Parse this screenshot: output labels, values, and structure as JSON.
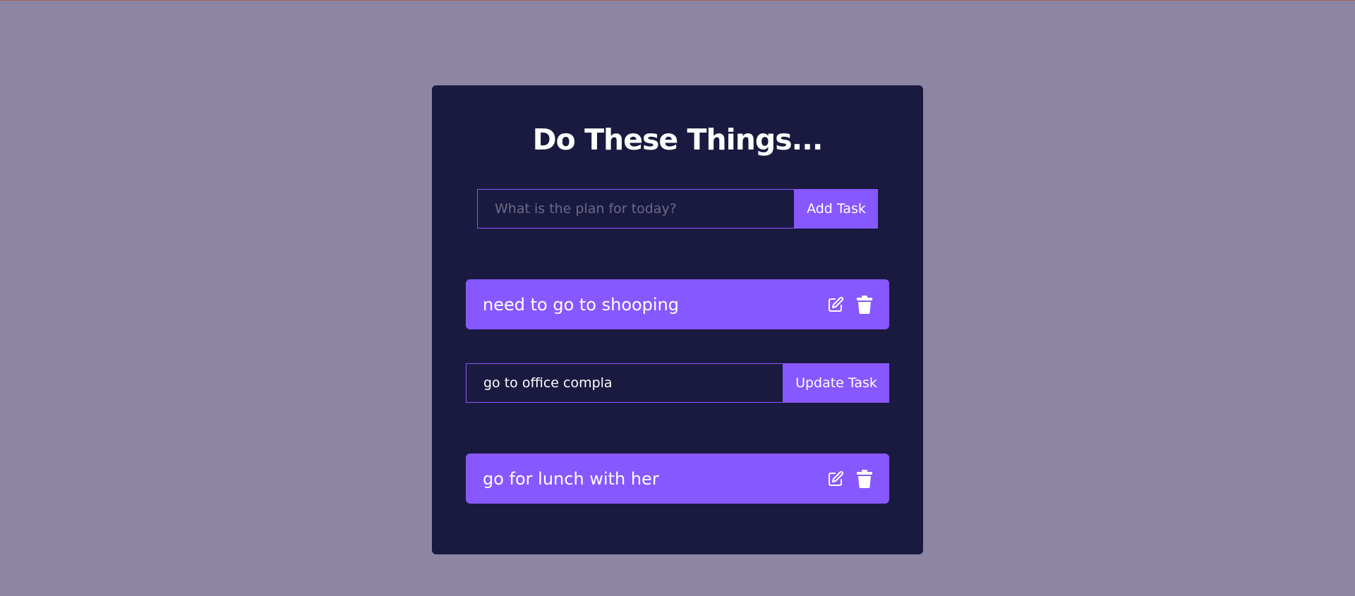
{
  "app": {
    "title": "Do These Things..."
  },
  "add_form": {
    "placeholder": "What is the plan for today?",
    "value": "",
    "button_label": "Add Task"
  },
  "todos": [
    {
      "text": "need to go to shooping",
      "icons": [
        "edit-icon",
        "trash-icon"
      ]
    },
    {
      "text": "go for lunch with her",
      "icons": [
        "edit-icon",
        "trash-icon"
      ]
    }
  ],
  "edit_form": {
    "value": "go to office compla",
    "button_label": "Update Task"
  },
  "colors": {
    "page_background": "#8d86a2",
    "card_background": "#1a1a40",
    "accent": "#8758ff",
    "text": "#ffffff",
    "placeholder": "#6b6a86"
  }
}
